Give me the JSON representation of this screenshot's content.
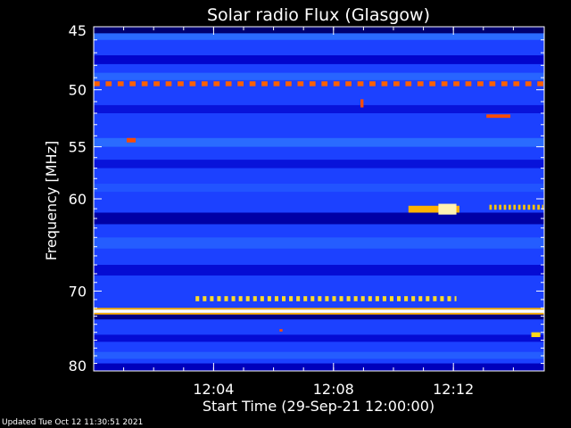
{
  "updated_label": "Updated Tue Oct 12 11:30:51 2021",
  "colors": {
    "background": "#000000",
    "axis": "#ffffff",
    "text": "#ffffff",
    "colormap": [
      "#00004a",
      "#0000c8",
      "#1a3cff",
      "#2a6bff",
      "#ff2a00",
      "#ffd400",
      "#ffffff"
    ]
  },
  "chart_data": {
    "type": "heatmap",
    "title": "Solar radio Flux (Glasgow)",
    "xlabel": "Start Time (29-Sep-21 12:00:00)",
    "ylabel": "Frequency [MHz]",
    "x_unit": "minutes after 12:00:00",
    "xlim": [
      0,
      15.03
    ],
    "ylim": [
      45,
      80
    ],
    "y_scale": "log",
    "y_inverted": true,
    "x_ticks": [
      {
        "value": 4,
        "label": "12:04"
      },
      {
        "value": 8,
        "label": "12:08"
      },
      {
        "value": 12,
        "label": "12:12"
      }
    ],
    "y_ticks": [
      {
        "value": 45,
        "label": "45"
      },
      {
        "value": 50,
        "label": "50"
      },
      {
        "value": 55,
        "label": "55"
      },
      {
        "value": 60,
        "label": "60"
      },
      {
        "value": 70,
        "label": "70"
      },
      {
        "value": 80,
        "label": "80"
      }
    ],
    "y_minor_ticks": [
      46,
      47,
      48,
      49,
      51,
      52,
      53,
      54,
      56,
      57,
      58,
      59,
      61,
      62,
      63,
      64,
      65,
      66,
      67,
      68,
      69,
      71,
      72,
      73,
      74,
      75,
      76,
      77,
      78,
      79
    ],
    "background_intensity": 0.35,
    "bands": [
      {
        "f0": 45.0,
        "f1": 45.5,
        "intensity": 0.05
      },
      {
        "f0": 45.5,
        "f1": 46.0,
        "intensity": 0.5
      },
      {
        "f0": 47.2,
        "f1": 47.9,
        "intensity": 0.18
      },
      {
        "f0": 48.6,
        "f1": 49.2,
        "intensity": 0.48
      },
      {
        "f0": 51.3,
        "f1": 52.0,
        "intensity": 0.22
      },
      {
        "f0": 54.2,
        "f1": 55.0,
        "intensity": 0.5
      },
      {
        "f0": 56.2,
        "f1": 57.0,
        "intensity": 0.22
      },
      {
        "f0": 58.5,
        "f1": 59.3,
        "intensity": 0.42
      },
      {
        "f0": 61.4,
        "f1": 62.6,
        "intensity": 0.12
      },
      {
        "f0": 64.0,
        "f1": 65.2,
        "intensity": 0.45
      },
      {
        "f0": 67.0,
        "f1": 68.2,
        "intensity": 0.2
      },
      {
        "f0": 72.6,
        "f1": 73.4,
        "intensity": 0.08
      },
      {
        "f0": 75.3,
        "f1": 76.2,
        "intensity": 0.2
      },
      {
        "f0": 77.5,
        "f1": 78.4,
        "intensity": 0.45
      },
      {
        "f0": 79.0,
        "f1": 80.0,
        "intensity": 0.15
      }
    ],
    "lines": [
      {
        "f0": 72.2,
        "f1": 72.6,
        "intensity": 1.0
      },
      {
        "f0": 72.0,
        "f1": 72.2,
        "intensity": 0.8
      },
      {
        "f0": 72.6,
        "f1": 72.8,
        "intensity": 0.8
      }
    ],
    "segments": [
      {
        "t0": 0.0,
        "t1": 15.03,
        "f0": 49.3,
        "f1": 49.7,
        "intensity": 0.72,
        "dash": 0.2
      },
      {
        "t0": 3.4,
        "t1": 12.1,
        "f0": 70.6,
        "f1": 71.2,
        "intensity": 0.86,
        "dash": 0.12
      },
      {
        "t0": 10.5,
        "t1": 12.2,
        "f0": 60.7,
        "f1": 61.4,
        "intensity": 0.8,
        "dash": 0.0
      },
      {
        "t0": 11.5,
        "t1": 12.1,
        "f0": 60.5,
        "f1": 61.6,
        "intensity": 0.95,
        "dash": 0.0
      },
      {
        "t0": 13.2,
        "t1": 15.0,
        "f0": 60.6,
        "f1": 61.1,
        "intensity": 0.82,
        "dash": 0.08
      },
      {
        "t0": 13.1,
        "t1": 13.9,
        "f0": 52.1,
        "f1": 52.4,
        "intensity": 0.7,
        "dash": 0.0
      },
      {
        "t0": 1.1,
        "t1": 1.4,
        "f0": 54.2,
        "f1": 54.6,
        "intensity": 0.7,
        "dash": 0.0
      },
      {
        "t0": 8.9,
        "t1": 9.0,
        "f0": 50.8,
        "f1": 51.5,
        "intensity": 0.7,
        "dash": 0.0
      },
      {
        "t0": 14.6,
        "t1": 14.9,
        "f0": 75.0,
        "f1": 75.6,
        "intensity": 0.85,
        "dash": 0.0
      },
      {
        "t0": 6.2,
        "t1": 6.3,
        "f0": 74.6,
        "f1": 74.9,
        "intensity": 0.7,
        "dash": 0.0
      }
    ]
  }
}
